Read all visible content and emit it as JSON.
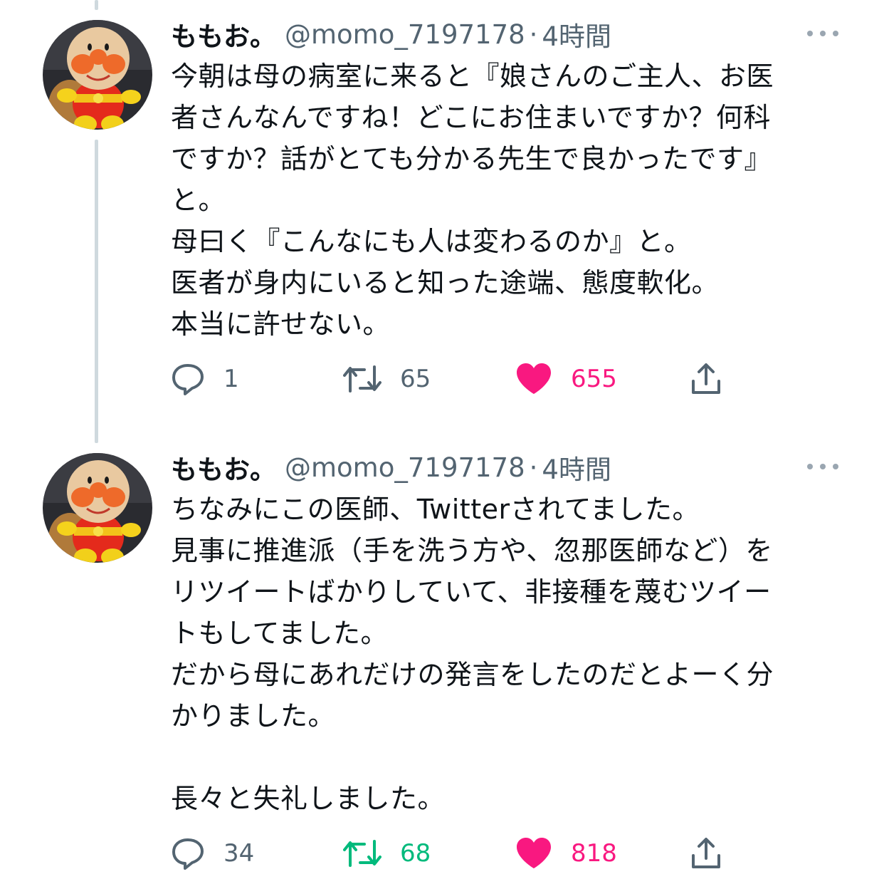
{
  "tweets": [
    {
      "author_name": "ももお。",
      "handle": "@momo_7197178",
      "separator": "·",
      "time": "4時間",
      "body_lines": [
        "今朝は母の病室に来ると『娘さんのご主人、お医",
        "者さんなんですね！どこにお住まいですか？何科",
        "ですか？話がとても分かる先生で良かったです』",
        "と。",
        "母曰く『こんなにも人は変わるのか』と。",
        "医者が身内にいると知った途端、態度軟化。",
        "本当に許せない。"
      ],
      "replies": "1",
      "retweets": "65",
      "likes": "655",
      "retweeted": false,
      "liked": true
    },
    {
      "author_name": "ももお。",
      "handle": "@momo_7197178",
      "separator": "·",
      "time": "4時間",
      "body_lines": [
        "ちなみにこの医師、Twitterされてました。",
        "見事に推進派（手を洗う方や、忽那医師など）を",
        "リツイートばかりしていて、非接種を蔑むツイー",
        "トもしてました。",
        "だから母にあれだけの発言をしたのだとよーく分",
        "かりました。",
        "",
        "長々と失礼しました。"
      ],
      "replies": "34",
      "retweets": "68",
      "likes": "818",
      "retweeted": true,
      "liked": true
    }
  ],
  "icons": {
    "reply": "reply-icon",
    "retweet": "retweet-icon",
    "like": "heart-icon",
    "share": "share-icon",
    "more": "more-icon",
    "avatar": "avatar-icon"
  },
  "colors": {
    "muted": "#536471",
    "retweet_active": "#00ba7c",
    "like_active": "#f91880",
    "thread_line": "#cfd9de"
  }
}
